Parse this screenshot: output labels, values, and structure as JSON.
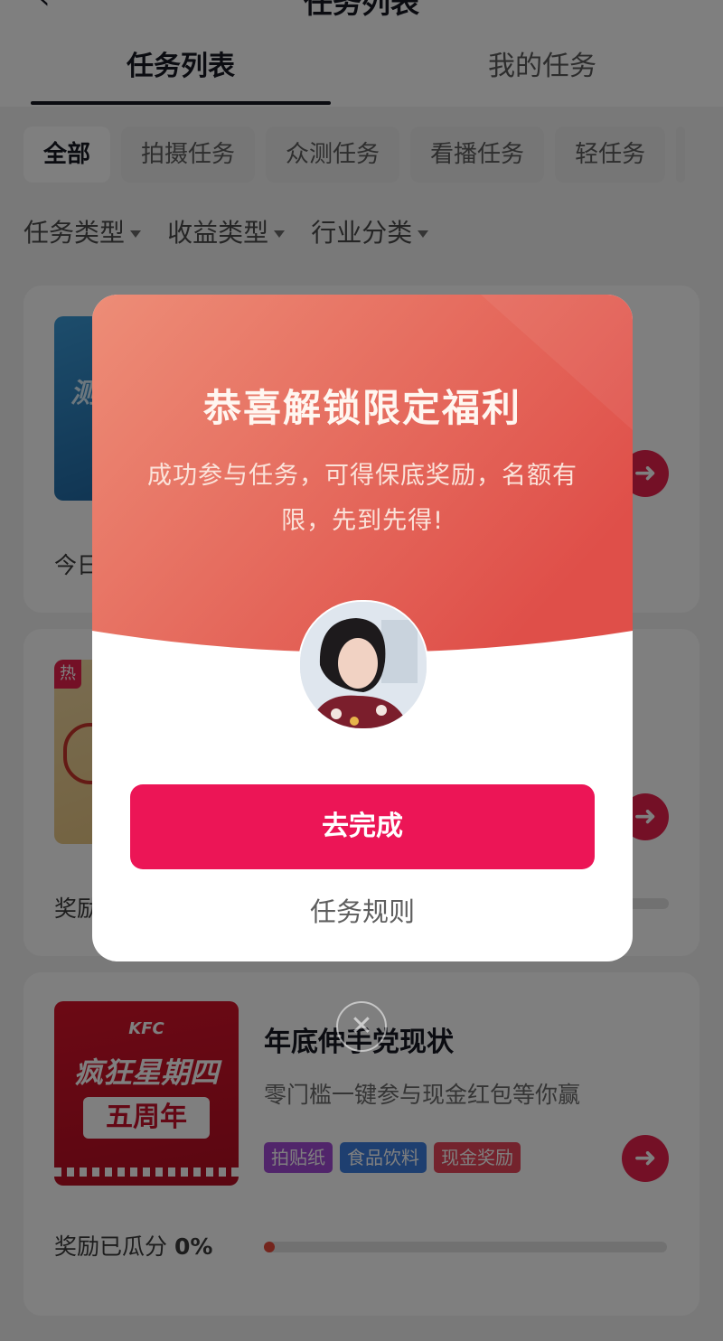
{
  "header": {
    "back_icon": "chevron-left-icon",
    "title": "任务列表",
    "tabs": [
      {
        "label": "任务列表",
        "active": true
      },
      {
        "label": "我的任务",
        "active": false
      }
    ]
  },
  "chips": [
    {
      "label": "全部",
      "active": true
    },
    {
      "label": "拍摄任务",
      "active": false
    },
    {
      "label": "众测任务",
      "active": false
    },
    {
      "label": "看播任务",
      "active": false
    },
    {
      "label": "轻任务",
      "active": false
    }
  ],
  "filters": [
    {
      "label": "任务类型"
    },
    {
      "label": "收益类型"
    },
    {
      "label": "行业分类"
    }
  ],
  "cards": [
    {
      "thumb_text": "测",
      "sub_text": "今日"
    },
    {
      "hot_badge": "热",
      "sub_text": "奖励"
    },
    {
      "thumb_brand": "KFC",
      "thumb_line1": "疯狂星期四",
      "thumb_line2": "五周年",
      "title": "年底伸手党现状",
      "desc": "零门槛一键参与现金红包等你赢",
      "tags": [
        {
          "label": "拍贴纸",
          "color": "#a34bd6"
        },
        {
          "label": "食品饮料",
          "color": "#3d7fe0"
        },
        {
          "label": "现金奖励",
          "color": "#e8475a"
        }
      ],
      "progress_label": "奖励已瓜分 ",
      "progress_pct_text": "0%",
      "progress_fraction": 0.0
    }
  ],
  "modal": {
    "title": "恭喜解锁限定福利",
    "subtitle": "成功参与任务，可得保底奖励，名额有限，先到先得!",
    "primary_button": "去完成",
    "rules_link": "任务规则",
    "close_icon": "close-icon"
  },
  "colors": {
    "accent": "#ec1556",
    "modal_gradient_start": "#ec8a74",
    "modal_gradient_end": "#e0524a"
  }
}
